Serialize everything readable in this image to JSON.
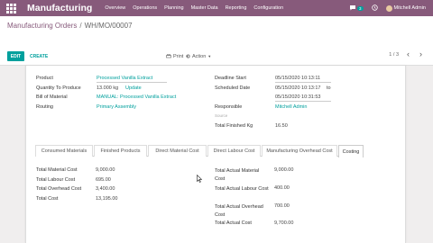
{
  "navbar": {
    "app_title": "Manufacturing",
    "menu": [
      "Overview",
      "Operations",
      "Planning",
      "Master Data",
      "Reporting",
      "Configuration"
    ],
    "chat_count": "3",
    "user_name": "Mitchell Admin"
  },
  "breadcrumb": {
    "parent": "Manufacturing Orders",
    "separator": "/",
    "current": "WH/MO/00007"
  },
  "toolbar": {
    "edit_label": "EDIT",
    "create_label": "CREATE",
    "print_label": "Print",
    "action_label": "Action",
    "pager": "1 / 3"
  },
  "form": {
    "product_label": "Product",
    "product_value": "Processed Vanilla Extract",
    "qty_label": "Quantity To Produce",
    "qty_value": "13.000 kg",
    "qty_update": "Update",
    "bom_label": "Bill of Material",
    "bom_value": "MANUAL: Processed Vanilla Extract",
    "routing_label": "Routing",
    "routing_value": "Primary Assembly",
    "deadline_label": "Deadline Start",
    "deadline_value": "05/15/2020 10:13:11",
    "scheduled_label": "Scheduled Date",
    "scheduled_value": "05/15/2020 10:13:17",
    "scheduled_to": "to",
    "scheduled_end": "05/15/2020 10:31:53",
    "responsible_label": "Responsible",
    "responsible_value": "Mitchell Admin",
    "source_label": "Source",
    "total_finished_label": "Total Finished Kg",
    "total_finished_value": "16.50"
  },
  "tabs": [
    "Consumed Materials",
    "Finished Products",
    "Direct Material Cost",
    "Direct Labour Cost",
    "Manufacturing Overhead Cost",
    "Costing"
  ],
  "costing": {
    "left": [
      {
        "label": "Total Material Cost",
        "value": "9,000.00"
      },
      {
        "label": "Total Labour Cost",
        "value": "695.00"
      },
      {
        "label": "Total Overhead Cost",
        "value": "3,400.00"
      },
      {
        "label": "Total Cost",
        "value": "13,195.00"
      }
    ],
    "right": [
      {
        "label": "Total Actual Material Cost",
        "value": "9,000.00"
      },
      {
        "label": "Total Actual Labour Cost",
        "value": "400.00"
      },
      {
        "label": "Total Actual Overhead Cost",
        "value": "700.00"
      },
      {
        "label": "Total Actual Cost",
        "value": "9,700.00"
      }
    ]
  },
  "icons": [
    "apps-icon",
    "chat-icon",
    "clock-icon",
    "avatar",
    "caret-down-icon",
    "chevron-left-icon",
    "chevron-right-icon",
    "external-link-icon",
    "cursor-icon"
  ],
  "colors": {
    "brand": "#875a7b",
    "accent": "#00a09d"
  }
}
